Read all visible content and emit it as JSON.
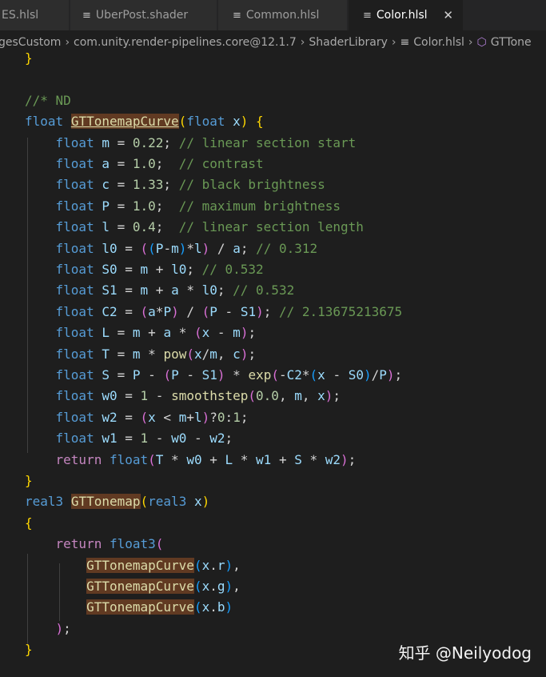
{
  "tabs": [
    {
      "label": "ES.hlsl",
      "active": false
    },
    {
      "label": "UberPost.shader",
      "active": false
    },
    {
      "label": "Common.hlsl",
      "active": false
    },
    {
      "label": "Color.hlsl",
      "active": true
    }
  ],
  "breadcrumb": [
    "gesCustom",
    "com.unity.render-pipelines.core@12.1.7",
    "ShaderLibrary",
    "Color.hlsl",
    "GTTone"
  ],
  "code": {
    "l0": {
      "t0": "}"
    },
    "l1": {
      "t0": "//* ND"
    },
    "l2": {
      "t0": "float",
      "t1": "GTTonemapCurve",
      "t2": "(",
      "t3": "float",
      "t4": "x",
      "t5": ")",
      "t6": "{"
    },
    "l3": {
      "t0": "float",
      "t1": "m",
      "t2": " = ",
      "t3": "0.22",
      "t4": "; ",
      "t5": "// linear section start"
    },
    "l4": {
      "t0": "float",
      "t1": "a",
      "t2": " = ",
      "t3": "1.0",
      "t4": ";  ",
      "t5": "// contrast"
    },
    "l5": {
      "t0": "float",
      "t1": "c",
      "t2": " = ",
      "t3": "1.33",
      "t4": "; ",
      "t5": "// black brightness"
    },
    "l6": {
      "t0": "float",
      "t1": "P",
      "t2": " = ",
      "t3": "1.0",
      "t4": ";  ",
      "t5": "// maximum brightness"
    },
    "l7": {
      "t0": "float",
      "t1": "l",
      "t2": " = ",
      "t3": "0.4",
      "t4": ";  ",
      "t5": "// linear section length"
    },
    "l8": {
      "t0": "float",
      "t1": "l0",
      "t2": " = ",
      "t3": "(",
      "t4": "(",
      "t5": "P",
      "t6": "-",
      "t7": "m",
      "t8": ")",
      "t9": "*",
      "t10": "l",
      "t11": ")",
      "t12": " / ",
      "t13": "a",
      "t14": "; ",
      "t15": "// 0.312"
    },
    "l9": {
      "t0": "float",
      "t1": "S0",
      "t2": " = ",
      "t3": "m",
      "t4": " + ",
      "t5": "l0",
      "t6": "; ",
      "t7": "// 0.532"
    },
    "l10": {
      "t0": "float",
      "t1": "S1",
      "t2": " = ",
      "t3": "m",
      "t4": " + ",
      "t5": "a",
      "t6": " * ",
      "t7": "l0",
      "t8": "; ",
      "t9": "// 0.532"
    },
    "l11": {
      "t0": "float",
      "t1": "C2",
      "t2": " = ",
      "t3": "(",
      "t4": "a",
      "t5": "*",
      "t6": "P",
      "t7": ")",
      "t8": " / ",
      "t9": "(",
      "t10": "P",
      "t11": " - ",
      "t12": "S1",
      "t13": ")",
      "t14": "; ",
      "t15": "// 2.13675213675"
    },
    "l12": {
      "t0": "float",
      "t1": "L",
      "t2": " = ",
      "t3": "m",
      "t4": " + ",
      "t5": "a",
      "t6": " * ",
      "t7": "(",
      "t8": "x",
      "t9": " - ",
      "t10": "m",
      "t11": ")",
      "t12": ";"
    },
    "l13": {
      "t0": "float",
      "t1": "T",
      "t2": " = ",
      "t3": "m",
      "t4": " * ",
      "t5": "pow",
      "t6": "(",
      "t7": "x",
      "t8": "/",
      "t9": "m",
      "t10": ", ",
      "t11": "c",
      "t12": ")",
      "t13": ";"
    },
    "l14": {
      "t0": "float",
      "t1": "S",
      "t2": " = ",
      "t3": "P",
      "t4": " - ",
      "t5": "(",
      "t6": "P",
      "t7": " - ",
      "t8": "S1",
      "t9": ")",
      "t10": " * ",
      "t11": "exp",
      "t12": "(",
      "t13": "-",
      "t14": "C2",
      "t15": "*",
      "t16": "(",
      "t17": "x",
      "t18": " - ",
      "t19": "S0",
      "t20": ")",
      "t21": "/",
      "t22": "P",
      "t23": ")",
      "t24": ";"
    },
    "l15": {
      "t0": "float",
      "t1": "w0",
      "t2": " = ",
      "t3": "1",
      "t4": " - ",
      "t5": "smoothstep",
      "t6": "(",
      "t7": "0.0",
      "t8": ", ",
      "t9": "m",
      "t10": ", ",
      "t11": "x",
      "t12": ")",
      "t13": ";"
    },
    "l16": {
      "t0": "float",
      "t1": "w2",
      "t2": " = ",
      "t3": "(",
      "t4": "x",
      "t5": " < ",
      "t6": "m",
      "t7": "+",
      "t8": "l",
      "t9": ")",
      "t10": "?",
      "t11": "0",
      "t12": ":",
      "t13": "1",
      "t14": ";"
    },
    "l17": {
      "t0": "float",
      "t1": "w1",
      "t2": " = ",
      "t3": "1",
      "t4": " - ",
      "t5": "w0",
      "t6": " - ",
      "t7": "w2",
      "t8": ";"
    },
    "l18": {
      "t0": "return",
      "t1": " ",
      "t2": "float",
      "t3": "(",
      "t4": "T",
      "t5": " * ",
      "t6": "w0",
      "t7": " + ",
      "t8": "L",
      "t9": " * ",
      "t10": "w1",
      "t11": " + ",
      "t12": "S",
      "t13": " * ",
      "t14": "w2",
      "t15": ")",
      "t16": ";"
    },
    "l19": {
      "t0": "}"
    },
    "l20": {
      "t0": "real3",
      "t1": " ",
      "t2": "GTTonemap",
      "t3": "(",
      "t4": "real3",
      "t5": " ",
      "t6": "x",
      "t7": ")"
    },
    "l21": {
      "t0": "{"
    },
    "l22": {
      "t0": "return",
      "t1": " ",
      "t2": "float3",
      "t3": "("
    },
    "l23": {
      "t0": "GTTonemapCurve",
      "t1": "(",
      "t2": "x",
      "t3": ".",
      "t4": "r",
      "t5": ")",
      "t6": ","
    },
    "l24": {
      "t0": "GTTonemapCurve",
      "t1": "(",
      "t2": "x",
      "t3": ".",
      "t4": "g",
      "t5": ")",
      "t6": ","
    },
    "l25": {
      "t0": "GTTonemapCurve",
      "t1": "(",
      "t2": "x",
      "t3": ".",
      "t4": "b",
      "t5": ")"
    },
    "l26": {
      "t0": ")",
      "t1": ";"
    },
    "l27": {
      "t0": "}"
    }
  },
  "watermark": "知乎 @Neilyodog",
  "colors": {
    "background": "#1e1e1e",
    "keyword": "#569cd6",
    "control": "#c586c0",
    "function": "#dcdcaa",
    "number": "#b5cea8",
    "comment": "#6a9955",
    "variable": "#9cdcfe",
    "bracket1": "#ffd700",
    "bracket2": "#da70d6",
    "bracket3": "#179fff",
    "highlight": "#613a22"
  }
}
